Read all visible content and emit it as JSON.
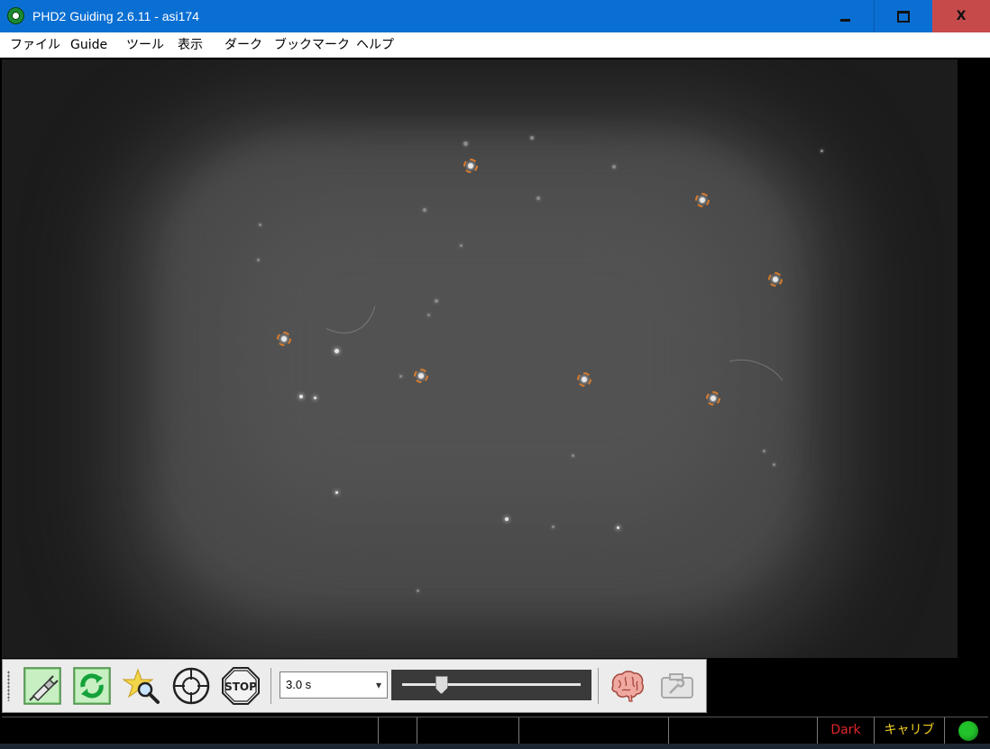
{
  "window": {
    "title": "PHD2 Guiding 2.6.11 - asi174",
    "minimize_glyph": "",
    "close_glyph": "X"
  },
  "menu": {
    "items": [
      "ファイル",
      "Guide",
      "ツール",
      "表示",
      "ダーク",
      "ブックマーク",
      "ヘルプ"
    ]
  },
  "toolbar": {
    "buttons": [
      {
        "name": "connect-equipment-icon",
        "icon": "usb-plug"
      },
      {
        "name": "loop-exposures-icon",
        "icon": "loop-arrows"
      },
      {
        "name": "auto-select-star-icon",
        "icon": "star-magnifier"
      },
      {
        "name": "start-guiding-icon",
        "icon": "crosshair"
      },
      {
        "name": "stop-icon",
        "icon": "stop-sign",
        "label": "STOP"
      },
      {
        "name": "brain-settings-icon",
        "icon": "brain"
      },
      {
        "name": "camera-settings-icon",
        "icon": "camera-wrench"
      }
    ],
    "exposure": {
      "value": "3.0 s"
    },
    "gamma_slider": {
      "value_fraction": 0.22
    }
  },
  "status": {
    "dark": "Dark",
    "calibration": "キャリブ",
    "led_color": "#22c22a"
  },
  "colors": {
    "titlebar": "#0a6fd3",
    "close_button": "#c64a4a",
    "star_marker": "#d77a2a"
  }
}
